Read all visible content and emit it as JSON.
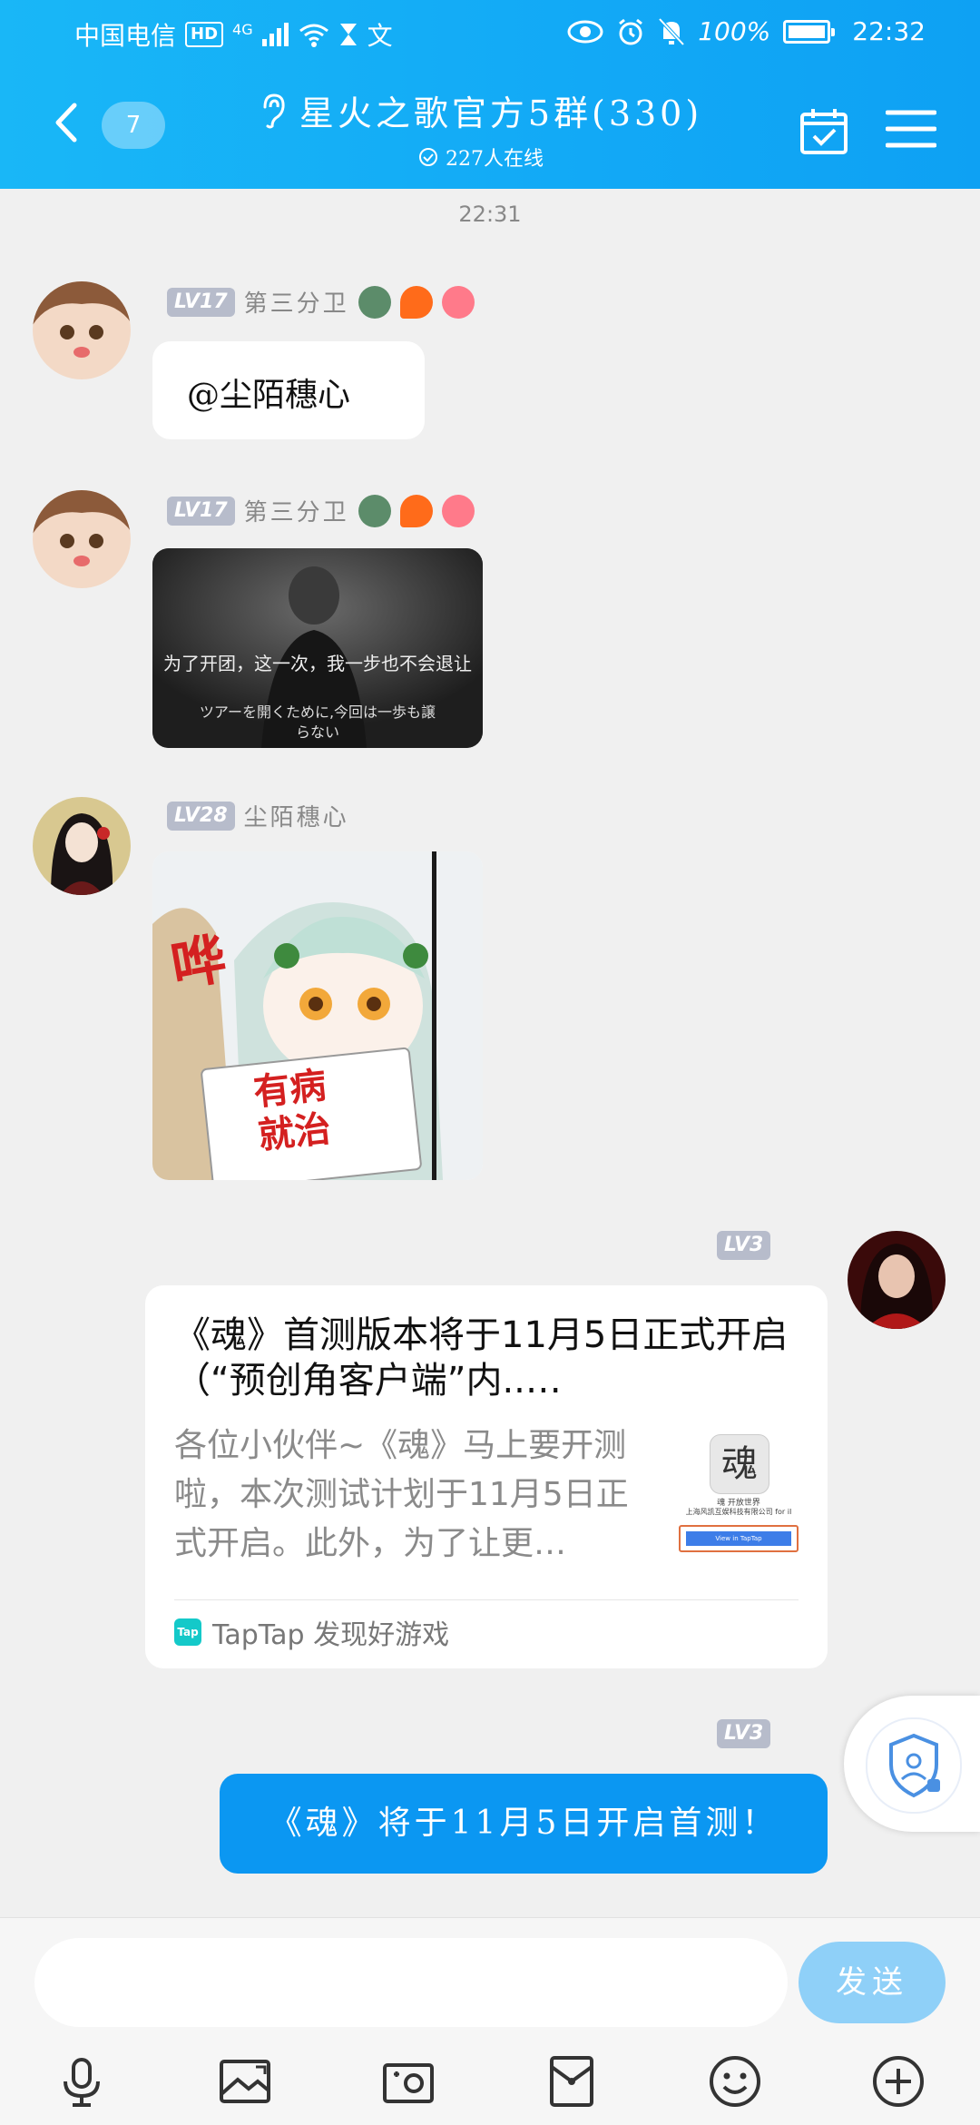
{
  "status_bar": {
    "carrier": "中国电信",
    "hd": "HD",
    "network": "4G",
    "extra": "文",
    "battery": "100%",
    "time": "22:32"
  },
  "header": {
    "unread_count": "7",
    "group_title": "星火之歌官方5群(330)",
    "online_text": "227人在线"
  },
  "time_divider": "22:31",
  "messages": [
    {
      "level": "LV17",
      "name": "第三分卫",
      "text": "@尘陌穗心"
    },
    {
      "level": "LV17",
      "name": "第三分卫",
      "image_caption_cn": "为了开团，这一次，我一步也不会退让",
      "image_caption_jp": "ツアーを開くために,今回は一歩も譲らない"
    },
    {
      "level": "LV28",
      "name": "尘陌穗心",
      "sticker_sfx": "哗",
      "sticker_sign": "有病就治"
    },
    {
      "level": "LV3",
      "card": {
        "title": "《魂》首测版本将于11月5日正式开启（“预创角客户端”内..…",
        "description": "各位小伙伴~《魂》马上要开测啦，本次测试计划于11月5日正式开启。此外，为了让更…",
        "thumb_app_name": "魂 开放世界",
        "thumb_company": "上海风凯互娱科技有限公司 for iI",
        "thumb_button": "View in TapTap",
        "source_logo": "Tap",
        "source": "TapTap 发现好游戏"
      }
    },
    {
      "level": "LV3",
      "text": "《魂》将于11月5日开启首测！"
    }
  ],
  "input": {
    "send_label": "发送"
  },
  "icons": [
    "back-arrow-icon",
    "ear-icon",
    "check-circle-icon",
    "calendar-check-icon",
    "menu-icon",
    "shield-user-icon",
    "microphone-icon",
    "image-icon",
    "camera-icon",
    "red-packet-icon",
    "emoji-icon",
    "plus-icon"
  ],
  "colors": {
    "header": "#12a9f6",
    "send_bubble": "#0b97f2",
    "send_button": "#8fd0f8",
    "level_badge": "#b7bccb"
  }
}
